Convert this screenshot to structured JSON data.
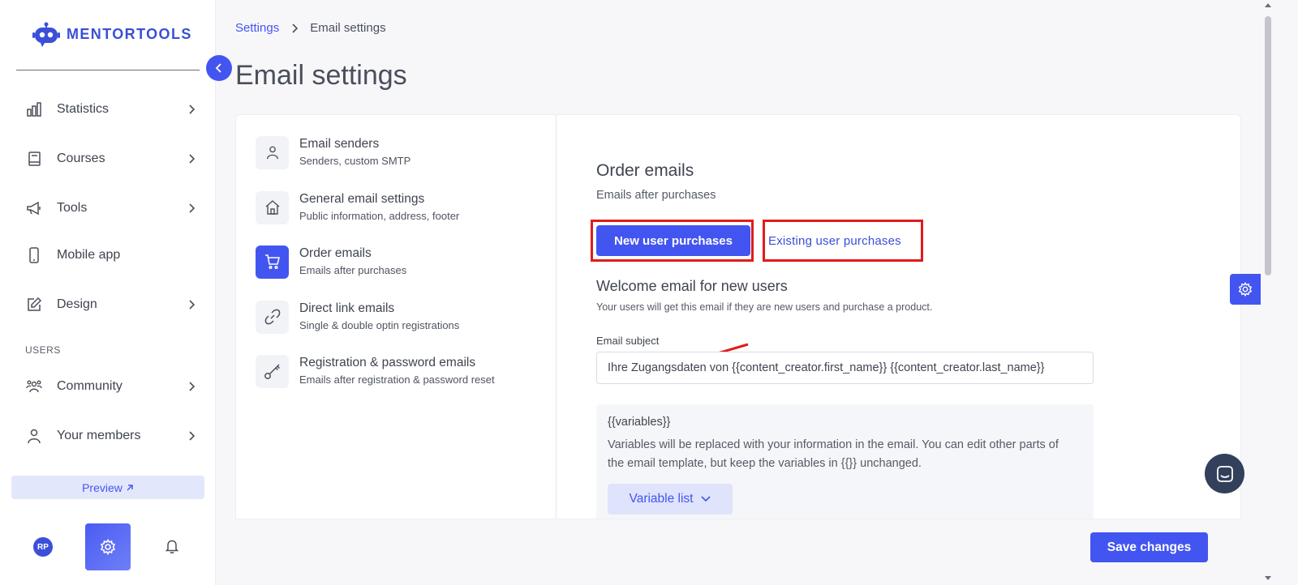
{
  "brand": {
    "name": "MENTORTOOLS",
    "accent": "#4355f0"
  },
  "sidebar": {
    "items": [
      {
        "label": "Statistics",
        "icon": "bar-chart-icon",
        "has_chevron": true
      },
      {
        "label": "Courses",
        "icon": "book-icon",
        "has_chevron": true
      },
      {
        "label": "Tools",
        "icon": "megaphone-icon",
        "has_chevron": true
      },
      {
        "label": "Mobile app",
        "icon": "mobile-icon",
        "has_chevron": false
      },
      {
        "label": "Design",
        "icon": "edit-icon",
        "has_chevron": true
      }
    ],
    "users_section_label": "USERS",
    "user_items": [
      {
        "label": "Community",
        "icon": "community-icon",
        "has_chevron": true
      },
      {
        "label": "Your members",
        "icon": "user-icon",
        "has_chevron": true
      }
    ],
    "preview_label": "Preview",
    "avatar_initials": "RP"
  },
  "breadcrumb": {
    "parent": "Settings",
    "current": "Email settings"
  },
  "page_title": "Email settings",
  "settings_menu": [
    {
      "title": "Email senders",
      "subtitle": "Senders, custom SMTP",
      "icon": "user-icon"
    },
    {
      "title": "General email settings",
      "subtitle": "Public information, address, footer",
      "icon": "home-icon"
    },
    {
      "title": "Order emails",
      "subtitle": "Emails after purchases",
      "icon": "cart-icon",
      "active": true
    },
    {
      "title": "Direct link emails",
      "subtitle": "Single & double optin registrations",
      "icon": "link-icon"
    },
    {
      "title": "Registration & password emails",
      "subtitle": "Emails after registration & password reset",
      "icon": "key-icon"
    }
  ],
  "order_emails": {
    "title": "Order emails",
    "subtitle": "Emails after purchases",
    "tabs": {
      "new": "New user purchases",
      "existing": "Existing user purchases"
    },
    "welcome_title": "Welcome email for new users",
    "welcome_desc": "Your users will get this email if they are new users and purchase a product.",
    "subject_label": "Email subject",
    "subject_value": "Ihre Zugangsdaten von {{content_creator.first_name}} {{content_creator.last_name}}",
    "variables_title": "{{variables}}",
    "variables_desc": "Variables will be replaced with your information in the email. You can edit other parts of the email template, but keep the variables in {{}} unchanged.",
    "variable_list_label": "Variable list"
  },
  "save_label": "Save changes",
  "highlight_color": "#e11b1b"
}
